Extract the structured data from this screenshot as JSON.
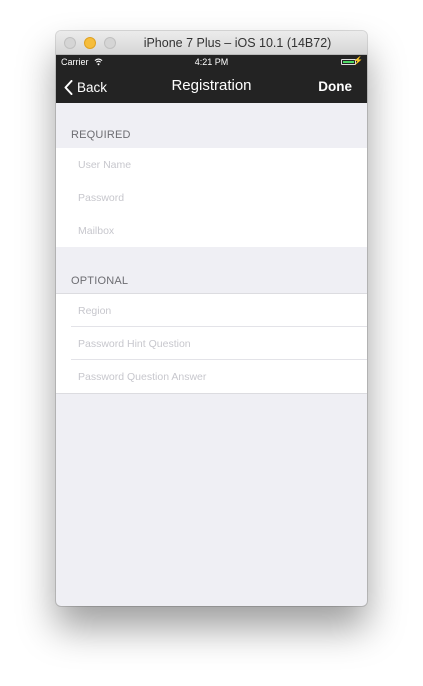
{
  "window": {
    "title": "iPhone 7 Plus – iOS 10.1 (14B72)"
  },
  "status_bar": {
    "carrier": "Carrier",
    "time": "4:21 PM",
    "wifi_icon": "wifi-icon",
    "battery_icon": "battery-icon",
    "battery_color": "#4cd964"
  },
  "nav": {
    "back_label": "Back",
    "title": "Registration",
    "done_label": "Done",
    "back_icon": "chevron-left-icon"
  },
  "required": {
    "header": "REQUIRED",
    "fields": [
      {
        "value": "",
        "placeholder": "User Name"
      },
      {
        "value": "",
        "placeholder": "Password"
      },
      {
        "value": "",
        "placeholder": "Mailbox"
      }
    ]
  },
  "optional": {
    "header": "OPTIONAL",
    "fields": [
      {
        "value": "",
        "placeholder": "Region"
      },
      {
        "value": "",
        "placeholder": "Password Hint Question"
      },
      {
        "value": "",
        "placeholder": "Password Question Answer"
      }
    ]
  }
}
